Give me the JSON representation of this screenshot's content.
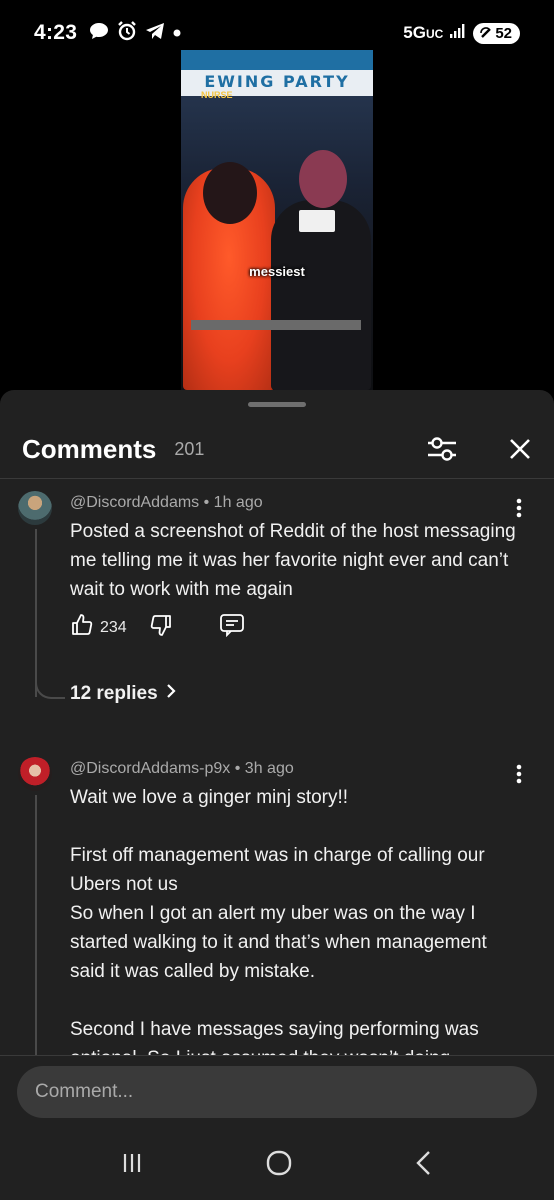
{
  "status_bar": {
    "time": "4:23",
    "network": "5G",
    "network_suffix": "UC",
    "battery": "52",
    "icons": [
      "chat-bubble-icon",
      "alarm-icon",
      "telegram-icon",
      "dot-icon",
      "signal-bars-icon"
    ]
  },
  "video": {
    "caption": "messiest",
    "banner_text": "EWING PARTY",
    "logo_text": "NURSE"
  },
  "comments_panel": {
    "title": "Comments",
    "count": "201",
    "filter_icon": "filter-sliders-icon",
    "close_icon": "close-icon"
  },
  "comments": [
    {
      "author": "@DiscordAddams",
      "time": "1h ago",
      "text": "Posted a screenshot of Reddit of the host messaging me telling me it was her favorite night ever and can’t wait to work with me again",
      "likes": "234",
      "replies_label": "12 replies"
    },
    {
      "author": "@DiscordAddams-p9x",
      "time": "3h ago",
      "text": "Wait we love a ginger minj story!!\n\nFirst off management was in charge of calling our Ubers not us\nSo when I got an alert my uber was on the way I started walking to it and that’s when management said it was called by mistake.\n\nSecond I have messages saying performing was optional. So I just assumed they wasn’t doing"
    }
  ],
  "comment_input": {
    "placeholder": "Comment..."
  },
  "nav": {
    "recents_icon": "recent-apps-icon",
    "home_icon": "home-icon",
    "back_icon": "back-icon"
  }
}
